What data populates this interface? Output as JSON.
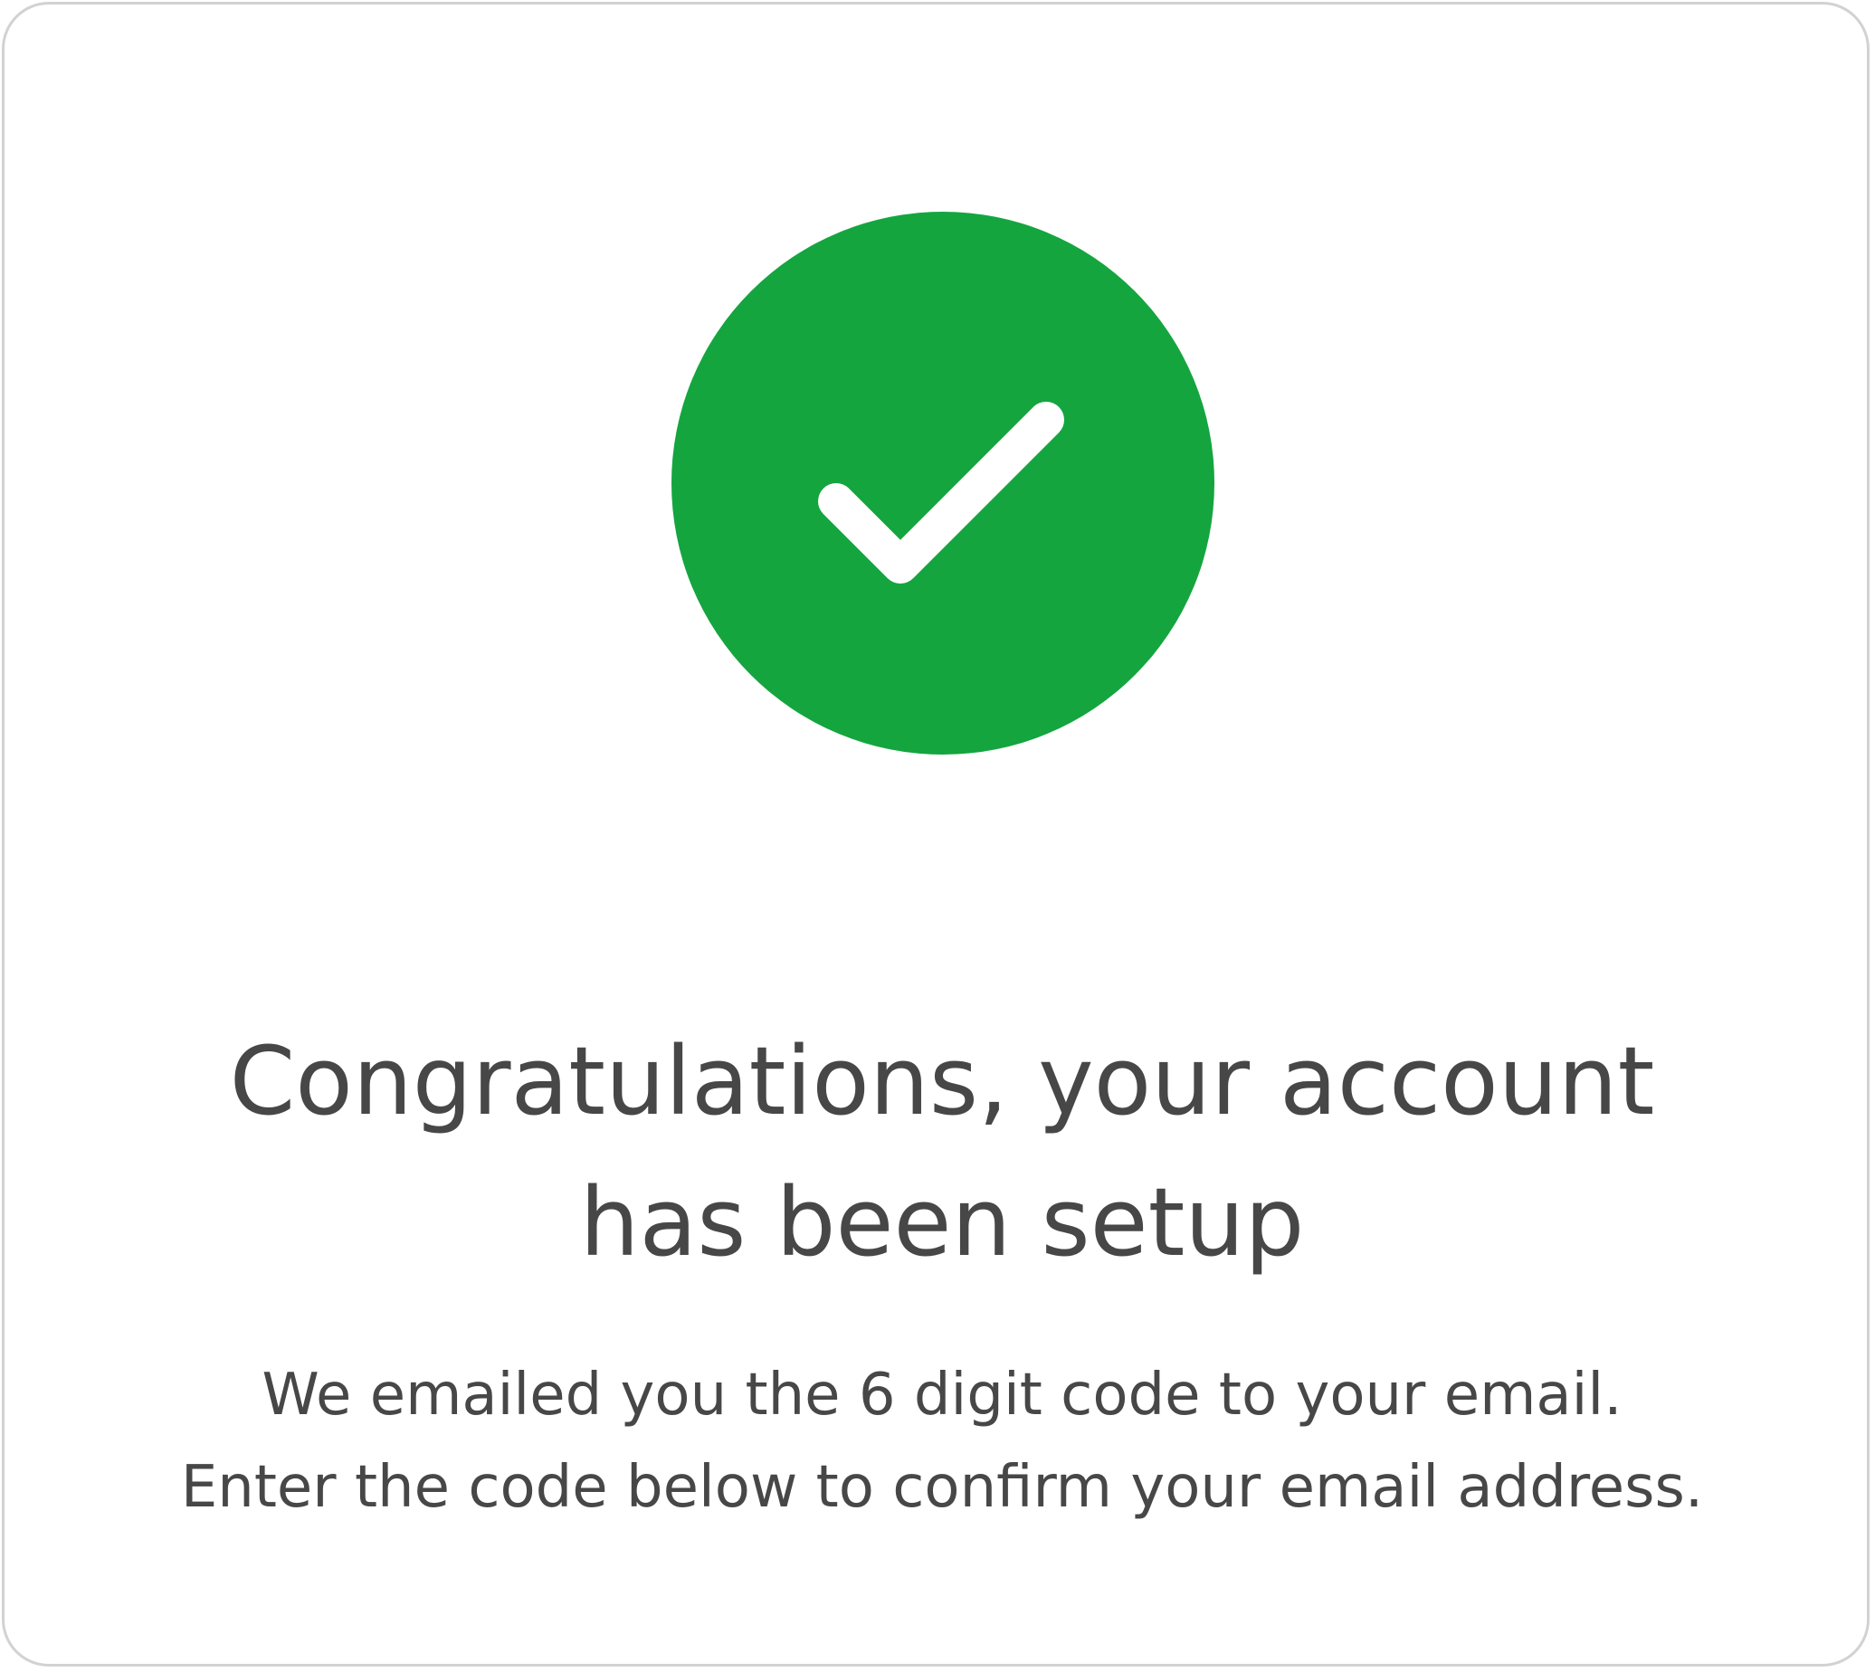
{
  "success_icon": {
    "name": "check-icon",
    "circle_color": "#14a53f",
    "check_color": "#ffffff"
  },
  "heading": {
    "line1": "Congratulations, your account",
    "line2": "has been setup"
  },
  "message": {
    "line1": "We emailed you the 6 digit code to your email.",
    "line2": "Enter the code below to confirm your email address."
  }
}
